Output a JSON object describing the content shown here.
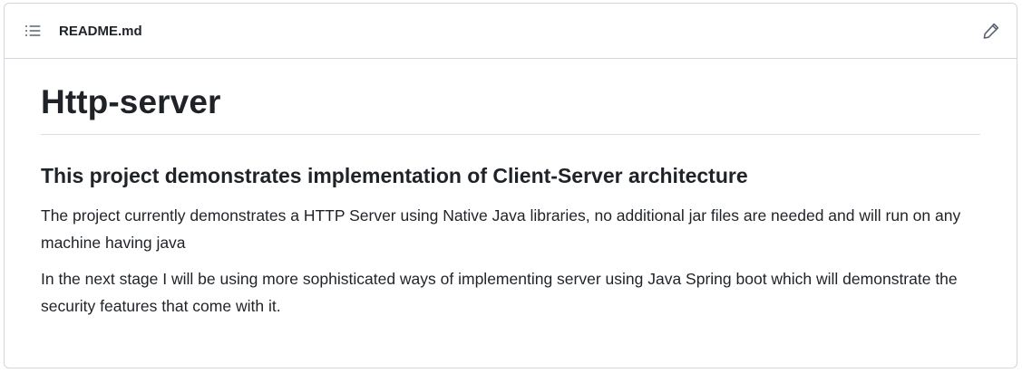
{
  "header": {
    "toc_icon": "list-unordered-icon",
    "file_name": "README.md",
    "edit_icon": "pencil-icon"
  },
  "readme": {
    "title": "Http-server",
    "subtitle": "This project demonstrates implementation of Client-Server architecture",
    "paragraphs": [
      "The project currently demonstrates a HTTP Server using Native Java libraries, no additional jar files are needed and will run on any machine having java",
      "In the next stage I will be using more sophisticated ways of implementing server using Java Spring boot which will demonstrate the security features that come with it."
    ]
  },
  "colors": {
    "text": "#1f2328",
    "border": "#d0d7de",
    "icon": "#59636e"
  }
}
